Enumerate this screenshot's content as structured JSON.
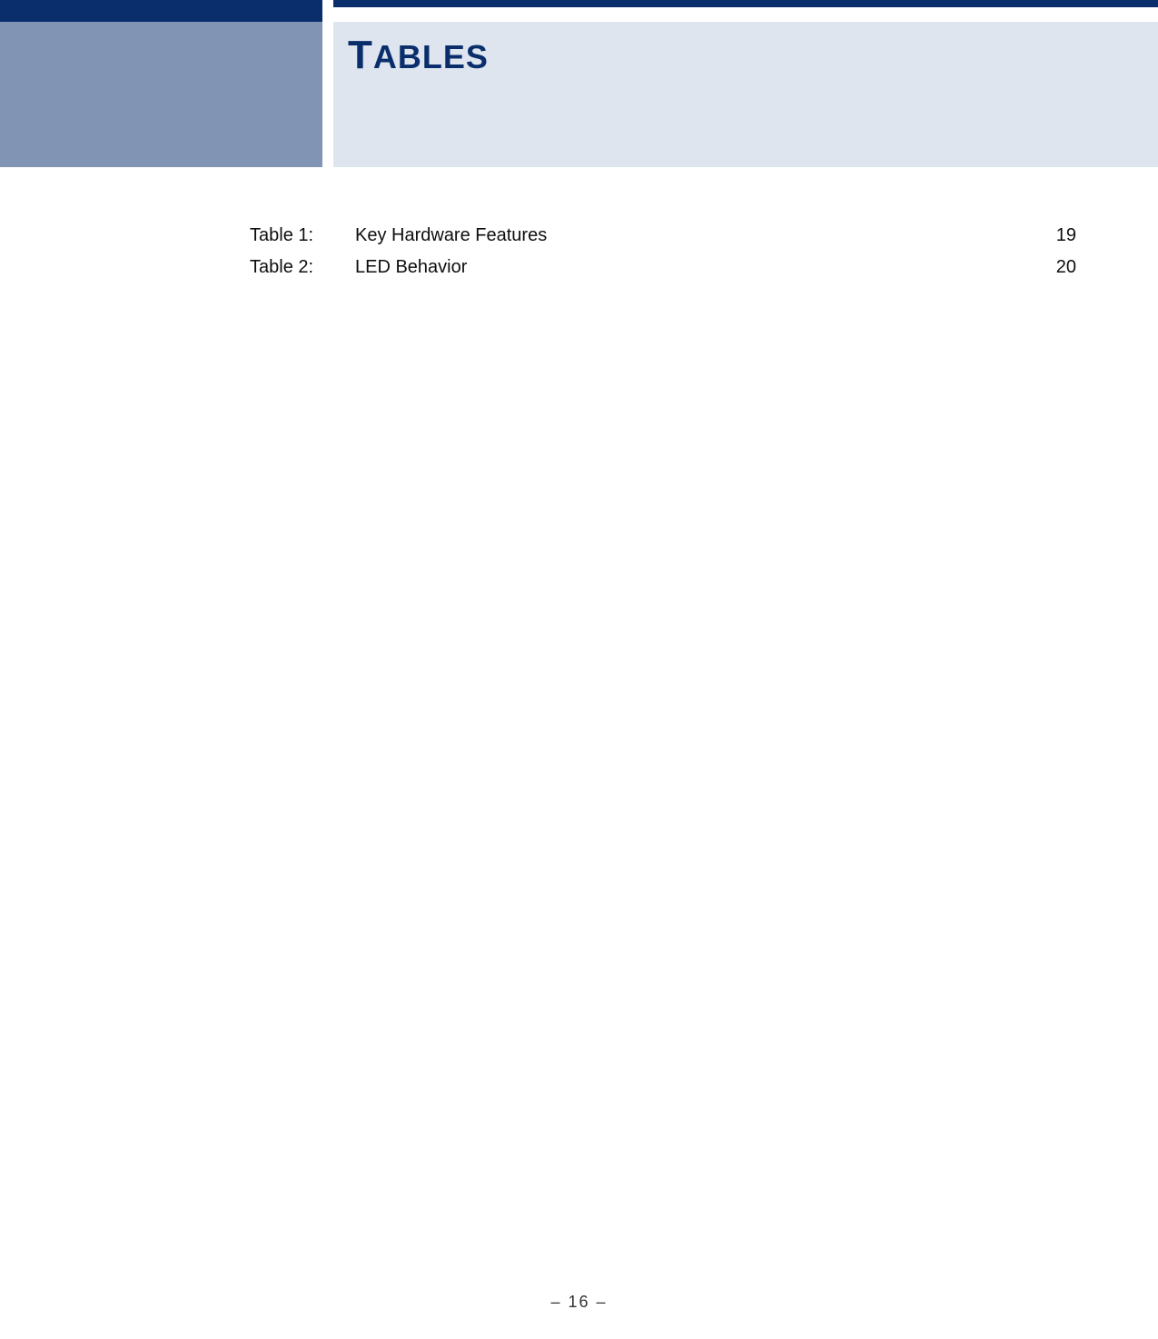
{
  "header": {
    "title_first": "T",
    "title_rest": "ABLES"
  },
  "toc": [
    {
      "label": "Table 1:",
      "text": "Key Hardware Features",
      "page": "19"
    },
    {
      "label": "Table 2:",
      "text": "LED Behavior",
      "page": "20"
    }
  ],
  "footer": {
    "page_number": "–  16  –"
  }
}
